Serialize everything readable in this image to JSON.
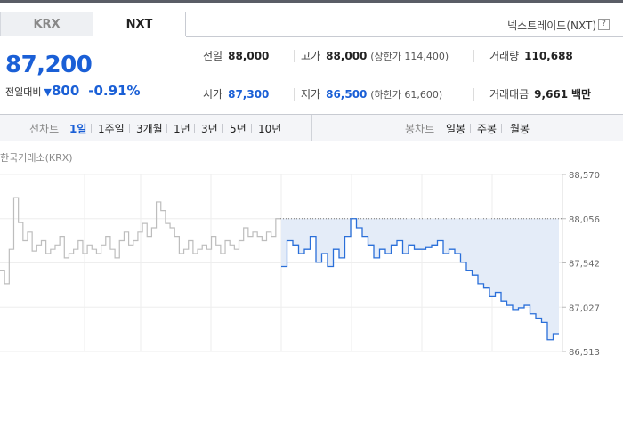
{
  "tabs": [
    {
      "label": "KRX",
      "active": false
    },
    {
      "label": "NXT",
      "active": true
    }
  ],
  "nxt_link": "넥스트레이드(NXT)",
  "help_icon": "?",
  "price": "87,200",
  "change": {
    "label": "전일대비",
    "direction": "down",
    "amount": "800",
    "percent": "-0.91%"
  },
  "stats": {
    "prev_close": {
      "label": "전일",
      "value": "88,000"
    },
    "high": {
      "label": "고가",
      "value": "88,000",
      "sub": "(상한가 114,400)"
    },
    "volume": {
      "label": "거래량",
      "value": "110,688"
    },
    "open": {
      "label": "시가",
      "value": "87,300"
    },
    "low": {
      "label": "저가",
      "value": "86,500",
      "sub": "(하한가 61,600)"
    },
    "trade_value": {
      "label": "거래대금",
      "value": "9,661",
      "unit": "백만"
    }
  },
  "line_chart_label": "선차트",
  "periods": [
    "1일",
    "1주일",
    "3개월",
    "1년",
    "3년",
    "5년",
    "10년"
  ],
  "active_period": "1일",
  "candle_chart_label": "봉차트",
  "candle_periods": [
    "일봉",
    "주봉",
    "월봉"
  ],
  "market_label": "한국거래소(KRX)",
  "colors": {
    "accent": "#1a5fd6",
    "line_today": "#2a6fd9",
    "line_prev": "#bdbdbd",
    "fill": "#e4ecf8"
  },
  "chart_data": {
    "type": "line",
    "y_ticks": [
      "88,570",
      "88,056",
      "87,542",
      "87,027",
      "86,513"
    ],
    "ylim": [
      86513,
      88570
    ],
    "reference_line": 88056,
    "grid": true,
    "series": [
      {
        "segment": "previous",
        "values": [
          87450,
          87300,
          87700,
          88300,
          88010,
          87800,
          87900,
          87680,
          87750,
          87800,
          87650,
          87700,
          87750,
          87850,
          87600,
          87650,
          87700,
          87800,
          87650,
          87750,
          87700,
          87650,
          87750,
          87850,
          87700,
          87600,
          87800,
          87900,
          87750,
          87800,
          87900,
          88000,
          87850,
          87950,
          88250,
          88150,
          88000,
          87950,
          87850,
          87650,
          87700,
          87800,
          87650,
          87700,
          87750,
          87700,
          87850,
          87750,
          87650,
          87800,
          87750,
          87700,
          87800,
          87950,
          87850,
          87900,
          87850,
          87800,
          87900,
          87850,
          88056,
          88056
        ]
      },
      {
        "segment": "today",
        "values": [
          87500,
          87800,
          87750,
          87650,
          87700,
          87850,
          87550,
          87650,
          87500,
          87700,
          87600,
          87850,
          88056,
          87950,
          87850,
          87750,
          87600,
          87700,
          87650,
          87750,
          87800,
          87650,
          87750,
          87700,
          87700,
          87720,
          87750,
          87800,
          87650,
          87700,
          87650,
          87550,
          87450,
          87400,
          87300,
          87250,
          87150,
          87200,
          87100,
          87050,
          87000,
          87020,
          87050,
          86950,
          86900,
          86850,
          86650,
          86720,
          86720
        ]
      }
    ]
  }
}
